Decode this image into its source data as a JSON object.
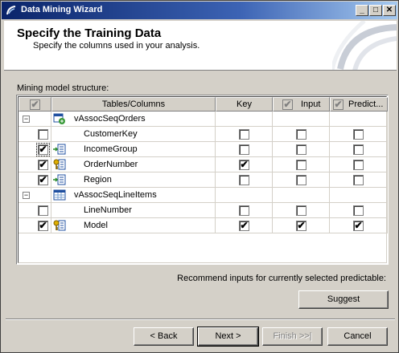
{
  "window": {
    "title": "Data Mining Wizard",
    "minimize_glyph": "_",
    "maximize_glyph": "□",
    "close_glyph": "✕"
  },
  "header": {
    "title": "Specify the Training Data",
    "subtitle": "Specify the columns used in your analysis."
  },
  "structure_label": "Mining model structure:",
  "grid": {
    "columns": [
      "Tables/Columns",
      "Key",
      "Input",
      "Predict..."
    ],
    "rows": [
      {
        "type": "table",
        "label": "vAssocSeqOrders",
        "expander": "−",
        "icon": "case-table-icon"
      },
      {
        "type": "column",
        "label": "CustomerKey",
        "selected": false,
        "key": false,
        "input": false,
        "predict": false,
        "icon": "none"
      },
      {
        "type": "column",
        "label": "IncomeGroup",
        "selected": true,
        "key": false,
        "input": false,
        "predict": false,
        "icon": "column-input-icon",
        "focused": true
      },
      {
        "type": "column",
        "label": "OrderNumber",
        "selected": true,
        "key": true,
        "input": false,
        "predict": false,
        "icon": "key-icon"
      },
      {
        "type": "column",
        "label": "Region",
        "selected": true,
        "key": false,
        "input": false,
        "predict": false,
        "icon": "column-input-icon"
      },
      {
        "type": "table",
        "label": "vAssocSeqLineItems",
        "expander": "−",
        "icon": "nested-table-icon"
      },
      {
        "type": "column",
        "label": "LineNumber",
        "selected": false,
        "key": false,
        "input": false,
        "predict": false,
        "icon": "none"
      },
      {
        "type": "column",
        "label": "Model",
        "selected": true,
        "key": true,
        "input": true,
        "predict": true,
        "icon": "key-icon"
      }
    ]
  },
  "recommend_text": "Recommend inputs for currently selected predictable:",
  "buttons": {
    "suggest": "Suggest",
    "back": "< Back",
    "next": "Next >",
    "finish": "Finish >>|",
    "cancel": "Cancel"
  },
  "check_glyph": "✔"
}
